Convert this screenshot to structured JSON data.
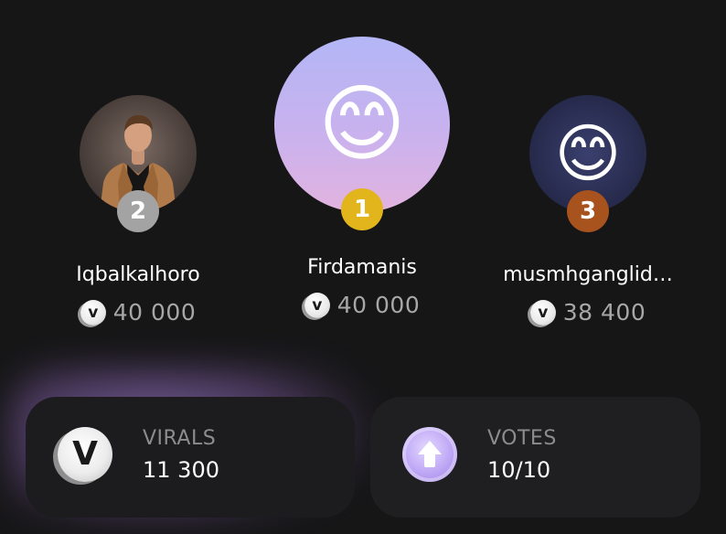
{
  "podium": [
    {
      "rank": "2",
      "name": "Iqbalkalhoro",
      "score": "40 000",
      "avatar": "photo-man-in-tan-blazer",
      "badge_color": "#a3a3a3"
    },
    {
      "rank": "1",
      "name": "Firdamanis",
      "score": "40 000",
      "avatar": "😊",
      "badge_color": "#e3b51c"
    },
    {
      "rank": "3",
      "name": "musmhganglid…",
      "score": "38 400",
      "avatar": "😊",
      "badge_color": "#a8521e"
    }
  ],
  "coin_symbol": "v",
  "stats": {
    "virals": {
      "label": "VIRALS",
      "value": "11 300",
      "icon": "virals-coin-icon",
      "icon_symbol": "V"
    },
    "votes": {
      "label": "VOTES",
      "value": "10/10",
      "icon": "up-arrow-icon"
    }
  },
  "colors": {
    "background": "#161617",
    "card": "#1f1f21",
    "gold": "#e3b51c",
    "silver": "#a3a3a3",
    "bronze": "#a8521e",
    "muted_text": "#a7a7a9",
    "glow": "#be96ff"
  }
}
